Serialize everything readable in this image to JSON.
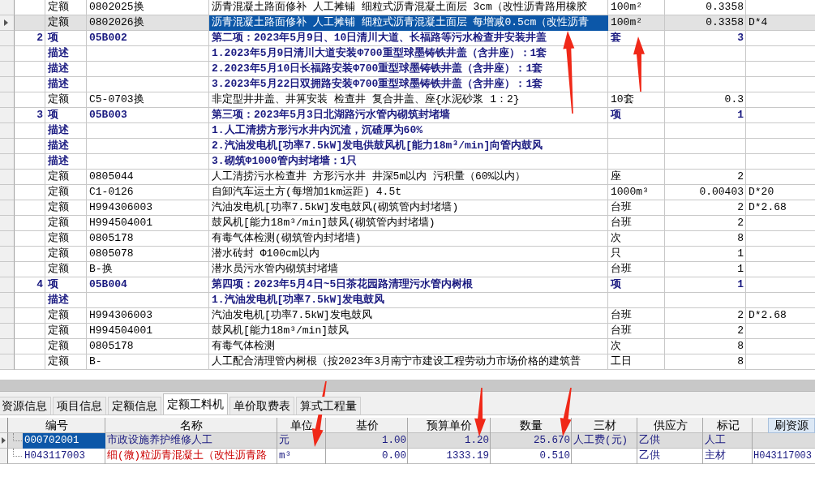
{
  "quota_grid": {
    "rows": [
      {
        "kind": "quota",
        "selected": false,
        "column_1": "",
        "column_2": "定额",
        "column_3": "0802025换",
        "column_4": "沥青混凝土路面修补 人工摊铺 细粒式沥青混凝土面层 3cm（改性沥青路用橡胶",
        "column_5": "100m²",
        "column_6": "0.3358",
        "column_7": ""
      },
      {
        "kind": "quota",
        "selected": true,
        "column_1": "",
        "column_2": "定额",
        "column_3": "0802026换",
        "column_4": "沥青混凝土路面修补 人工摊铺 细粒式沥青混凝土面层 每增减0.5cm（改性沥青",
        "column_5": "100m²",
        "column_6": "0.3358",
        "column_7": "D*4"
      },
      {
        "kind": "item",
        "selected": false,
        "column_1": "2",
        "column_2": "项",
        "column_3": "05B002",
        "column_4": "第二项：2023年5月9日、10日清川大道、长福路等污水检查井安装井盖",
        "column_5": "套",
        "column_6": "3",
        "column_7": ""
      },
      {
        "kind": "desc",
        "selected": false,
        "column_1": "",
        "column_2": "描述",
        "column_3": "",
        "column_4": "1.2023年5月9日清川大道安装Φ700重型球墨铸铁井盖（含井座）：1套",
        "column_5": "",
        "column_6": "",
        "column_7": ""
      },
      {
        "kind": "desc",
        "selected": false,
        "column_1": "",
        "column_2": "描述",
        "column_3": "",
        "column_4": "2.2023年5月10日长福路安装Φ700重型球墨铸铁井盖（含井座）：1套",
        "column_5": "",
        "column_6": "",
        "column_7": ""
      },
      {
        "kind": "desc",
        "selected": false,
        "column_1": "",
        "column_2": "描述",
        "column_3": "",
        "column_4": "3.2023年5月22日双拥路安装Φ700重型球墨铸铁井盖（含井座）：1套",
        "column_5": "",
        "column_6": "",
        "column_7": ""
      },
      {
        "kind": "quota",
        "selected": false,
        "column_1": "",
        "column_2": "定额",
        "column_3": "C5-0703换",
        "column_4": "非定型井井盖、井箅安装 检查井 复合井盖、座{水泥砂浆 1：2}",
        "column_5": "10套",
        "column_6": "0.3",
        "column_7": ""
      },
      {
        "kind": "item",
        "selected": false,
        "column_1": "3",
        "column_2": "项",
        "column_3": "05B003",
        "column_4": "第三项：2023年5月3日北湖路污水管内砌筑封堵墙",
        "column_5": "项",
        "column_6": "1",
        "column_7": ""
      },
      {
        "kind": "desc",
        "selected": false,
        "column_1": "",
        "column_2": "描述",
        "column_3": "",
        "column_4": "1.人工清捞方形污水井内沉渣，沉碴厚为60%",
        "column_5": "",
        "column_6": "",
        "column_7": ""
      },
      {
        "kind": "desc",
        "selected": false,
        "column_1": "",
        "column_2": "描述",
        "column_3": "",
        "column_4": "2.汽油发电机[功率7.5kW]发电供鼓风机[能力18m³/min]向管内鼓风",
        "column_5": "",
        "column_6": "",
        "column_7": ""
      },
      {
        "kind": "desc",
        "selected": false,
        "column_1": "",
        "column_2": "描述",
        "column_3": "",
        "column_4": "3.砌筑Φ1000管内封堵墙：1只",
        "column_5": "",
        "column_6": "",
        "column_7": ""
      },
      {
        "kind": "quota",
        "selected": false,
        "column_1": "",
        "column_2": "定额",
        "column_3": "0805044",
        "column_4": "人工清捞污水检查井 方形污水井 井深5m以内 污积量（60%以内）",
        "column_5": "座",
        "column_6": "2",
        "column_7": ""
      },
      {
        "kind": "quota",
        "selected": false,
        "column_1": "",
        "column_2": "定额",
        "column_3": "C1-0126",
        "column_4": "自卸汽车运土方(每增加1km运距) 4.5t",
        "column_5": "1000m³",
        "column_6": "0.00403",
        "column_7": "D*20"
      },
      {
        "kind": "quota",
        "selected": false,
        "column_1": "",
        "column_2": "定额",
        "column_3": "H994306003",
        "column_4": "汽油发电机[功率7.5kW]发电鼓风(砌筑管内封堵墙)",
        "column_5": "台班",
        "column_6": "2",
        "column_7": "D*2.68"
      },
      {
        "kind": "quota",
        "selected": false,
        "column_1": "",
        "column_2": "定额",
        "column_3": "H994504001",
        "column_4": "鼓风机[能力18m³/min]鼓风(砌筑管内封堵墙)",
        "column_5": "台班",
        "column_6": "2",
        "column_7": ""
      },
      {
        "kind": "quota",
        "selected": false,
        "column_1": "",
        "column_2": "定额",
        "column_3": "0805178",
        "column_4": "有毒气体检测(砌筑管内封堵墙)",
        "column_5": "次",
        "column_6": "8",
        "column_7": ""
      },
      {
        "kind": "quota",
        "selected": false,
        "column_1": "",
        "column_2": "定额",
        "column_3": "0805078",
        "column_4": "潜水砖封 Φ100cm以内",
        "column_5": "只",
        "column_6": "1",
        "column_7": ""
      },
      {
        "kind": "quota",
        "selected": false,
        "column_1": "",
        "column_2": "定额",
        "column_3": "B-换",
        "column_4": "潜水员污水管内砌筑封堵墙",
        "column_5": "台班",
        "column_6": "1",
        "column_7": ""
      },
      {
        "kind": "item",
        "selected": false,
        "column_1": "4",
        "column_2": "项",
        "column_3": "05B004",
        "column_4": "第四项：2023年5月4日~5日茶花园路清理污水管内树根",
        "column_5": "项",
        "column_6": "1",
        "column_7": ""
      },
      {
        "kind": "desc",
        "selected": false,
        "column_1": "",
        "column_2": "描述",
        "column_3": "",
        "column_4": "1.汽油发电机[功率7.5kW]发电鼓风",
        "column_5": "",
        "column_6": "",
        "column_7": ""
      },
      {
        "kind": "quota",
        "selected": false,
        "column_1": "",
        "column_2": "定额",
        "column_3": "H994306003",
        "column_4": "汽油发电机[功率7.5kW]发电鼓风",
        "column_5": "台班",
        "column_6": "2",
        "column_7": "D*2.68"
      },
      {
        "kind": "quota",
        "selected": false,
        "column_1": "",
        "column_2": "定额",
        "column_3": "H994504001",
        "column_4": "鼓风机[能力18m³/min]鼓风",
        "column_5": "台班",
        "column_6": "2",
        "column_7": ""
      },
      {
        "kind": "quota",
        "selected": false,
        "column_1": "",
        "column_2": "定额",
        "column_3": "0805178",
        "column_4": "有毒气体检测",
        "column_5": "次",
        "column_6": "8",
        "column_7": ""
      },
      {
        "kind": "quota",
        "selected": false,
        "column_1": "",
        "column_2": "定额",
        "column_3": "B-",
        "column_4": "人工配合清理管内树根（按2023年3月南宁市建设工程劳动力市场价格的建筑普",
        "column_5": "工日",
        "column_6": "8",
        "column_7": ""
      }
    ]
  },
  "tabs": [
    {
      "label": "资源信息",
      "selected": false
    },
    {
      "label": "项目信息",
      "selected": false
    },
    {
      "label": "定额信息",
      "selected": false
    },
    {
      "label": "定额工料机",
      "selected": true
    },
    {
      "label": "单价取费表",
      "selected": false
    },
    {
      "label": "算式工程量",
      "selected": false
    }
  ],
  "resource_grid": {
    "columns": [
      "编号",
      "名称",
      "单位",
      "基价",
      "预算单价",
      "数量",
      "三材",
      "供应方",
      "标记"
    ],
    "button": "刷资源",
    "rows": [
      {
        "selected": true,
        "color": "#1a1a80",
        "cells": [
          "000702001",
          "市政设施养护维修人工",
          "元",
          "1.00",
          "1.20",
          "25.670",
          "人工费(元)",
          "乙供",
          "人工",
          ""
        ]
      },
      {
        "selected": false,
        "color": "#cc0000",
        "cells": [
          "H043117003",
          "细(微)粒沥青混凝土（改性沥青路",
          "m³",
          "0.00",
          "1333.19",
          "0.510",
          "",
          "乙供",
          "主材",
          "H043117003"
        ]
      }
    ]
  }
}
